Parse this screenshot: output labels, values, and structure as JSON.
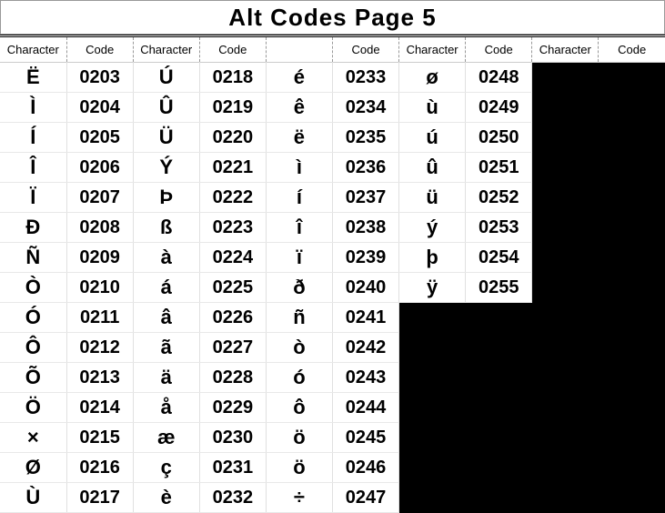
{
  "title": "Alt Codes Page 5",
  "headers": {
    "character": "Character",
    "code": "Code"
  },
  "columns": [
    [
      {
        "char": "Ë",
        "code": "0203"
      },
      {
        "char": "Ì",
        "code": "0204"
      },
      {
        "char": "Í",
        "code": "0205"
      },
      {
        "char": "Î",
        "code": "0206"
      },
      {
        "char": "Ï",
        "code": "0207"
      },
      {
        "char": "Ð",
        "code": "0208"
      },
      {
        "char": "Ñ",
        "code": "0209"
      },
      {
        "char": "Ò",
        "code": "0210"
      },
      {
        "char": "Ó",
        "code": "0211"
      },
      {
        "char": "Ô",
        "code": "0212"
      },
      {
        "char": "Õ",
        "code": "0213"
      },
      {
        "char": "Ö",
        "code": "0214"
      },
      {
        "char": "×",
        "code": "0215"
      },
      {
        "char": "Ø",
        "code": "0216"
      },
      {
        "char": "Ù",
        "code": "0217"
      }
    ],
    [
      {
        "char": "Ú",
        "code": "0218"
      },
      {
        "char": "Û",
        "code": "0219"
      },
      {
        "char": "Ü",
        "code": "0220"
      },
      {
        "char": "Ý",
        "code": "0221"
      },
      {
        "char": "Þ",
        "code": "0222"
      },
      {
        "char": "ß",
        "code": "0223"
      },
      {
        "char": "à",
        "code": "0224"
      },
      {
        "char": "á",
        "code": "0225"
      },
      {
        "char": "â",
        "code": "0226"
      },
      {
        "char": "ã",
        "code": "0227"
      },
      {
        "char": "ä",
        "code": "0228"
      },
      {
        "char": "å",
        "code": "0229"
      },
      {
        "char": "æ",
        "code": "0230"
      },
      {
        "char": "ç",
        "code": "0231"
      },
      {
        "char": "è",
        "code": "0232"
      }
    ],
    [
      {
        "char": "é",
        "code": "0233"
      },
      {
        "char": "ê",
        "code": "0234"
      },
      {
        "char": "ë",
        "code": "0235"
      },
      {
        "char": "ì",
        "code": "0236"
      },
      {
        "char": "í",
        "code": "0237"
      },
      {
        "char": "î",
        "code": "0238"
      },
      {
        "char": "ï",
        "code": "0239"
      },
      {
        "char": "ð",
        "code": "0240"
      },
      {
        "char": "ñ",
        "code": "0241"
      },
      {
        "char": "ò",
        "code": "0242"
      },
      {
        "char": "ó",
        "code": "0243"
      },
      {
        "char": "ô",
        "code": "0244"
      },
      {
        "char": "ö",
        "code": "0245"
      },
      {
        "char": "ö",
        "code": "0246"
      },
      {
        "char": "÷",
        "code": "0247"
      }
    ],
    [
      {
        "char": "ø",
        "code": "0248"
      },
      {
        "char": "ù",
        "code": "0249"
      },
      {
        "char": "ú",
        "code": "0250"
      },
      {
        "char": "û",
        "code": "0251"
      },
      {
        "char": "ü",
        "code": "0252"
      },
      {
        "char": "ý",
        "code": "0253"
      },
      {
        "char": "þ",
        "code": "0254"
      },
      {
        "char": "ÿ",
        "code": "0255"
      }
    ],
    []
  ],
  "rowCount": 15
}
